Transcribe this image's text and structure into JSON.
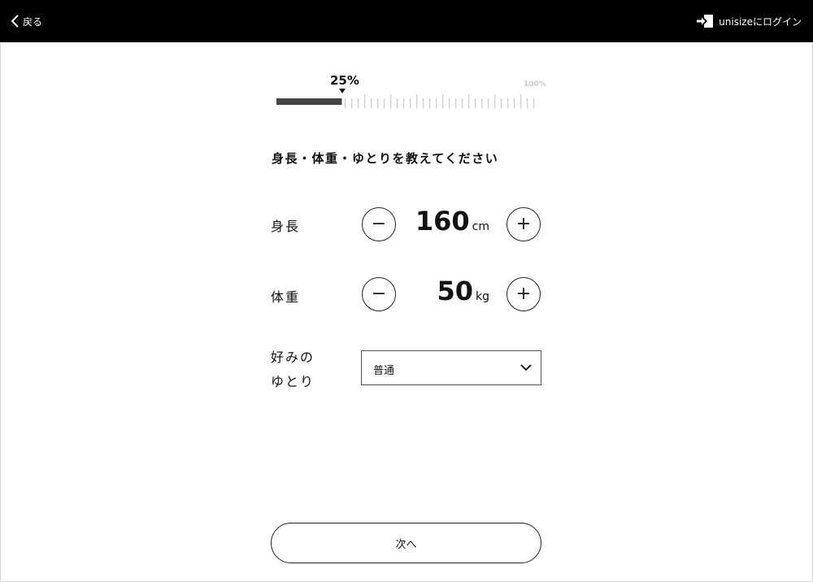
{
  "header": {
    "back_label": "戻る",
    "login_label": "unisizeにログイン"
  },
  "progress": {
    "percent_label": "25%",
    "max_label": "100%",
    "value": 0.25
  },
  "title": "身長・体重・ゆとりを教えてください",
  "height": {
    "label": "身長",
    "value": "160",
    "unit": "cm",
    "minus": "−",
    "plus": "+"
  },
  "weight": {
    "label": "体重",
    "value": "50",
    "unit": "kg",
    "minus": "−",
    "plus": "+"
  },
  "fit": {
    "label_line1": "好みの",
    "label_line2": "ゆとり",
    "selected": "普通"
  },
  "next_label": "次へ"
}
